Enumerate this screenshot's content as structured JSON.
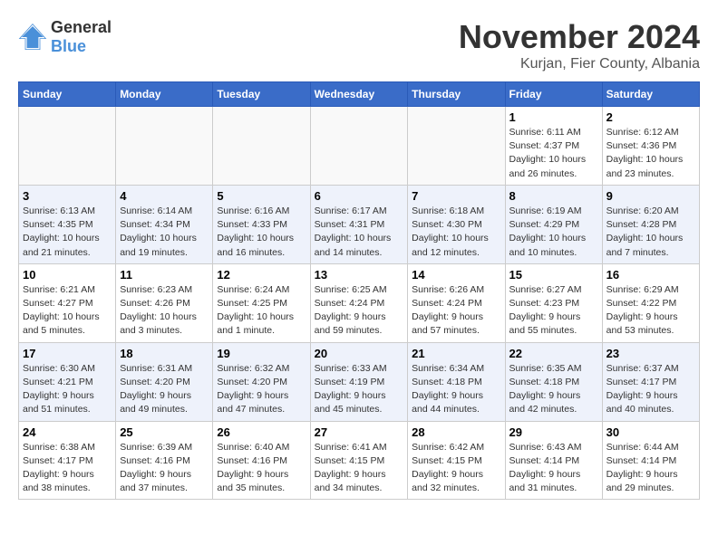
{
  "header": {
    "logo_general": "General",
    "logo_blue": "Blue",
    "month_title": "November 2024",
    "location": "Kurjan, Fier County, Albania"
  },
  "weekdays": [
    "Sunday",
    "Monday",
    "Tuesday",
    "Wednesday",
    "Thursday",
    "Friday",
    "Saturday"
  ],
  "weeks": [
    [
      {
        "day": "",
        "info": ""
      },
      {
        "day": "",
        "info": ""
      },
      {
        "day": "",
        "info": ""
      },
      {
        "day": "",
        "info": ""
      },
      {
        "day": "",
        "info": ""
      },
      {
        "day": "1",
        "info": "Sunrise: 6:11 AM\nSunset: 4:37 PM\nDaylight: 10 hours and 26 minutes."
      },
      {
        "day": "2",
        "info": "Sunrise: 6:12 AM\nSunset: 4:36 PM\nDaylight: 10 hours and 23 minutes."
      }
    ],
    [
      {
        "day": "3",
        "info": "Sunrise: 6:13 AM\nSunset: 4:35 PM\nDaylight: 10 hours and 21 minutes."
      },
      {
        "day": "4",
        "info": "Sunrise: 6:14 AM\nSunset: 4:34 PM\nDaylight: 10 hours and 19 minutes."
      },
      {
        "day": "5",
        "info": "Sunrise: 6:16 AM\nSunset: 4:33 PM\nDaylight: 10 hours and 16 minutes."
      },
      {
        "day": "6",
        "info": "Sunrise: 6:17 AM\nSunset: 4:31 PM\nDaylight: 10 hours and 14 minutes."
      },
      {
        "day": "7",
        "info": "Sunrise: 6:18 AM\nSunset: 4:30 PM\nDaylight: 10 hours and 12 minutes."
      },
      {
        "day": "8",
        "info": "Sunrise: 6:19 AM\nSunset: 4:29 PM\nDaylight: 10 hours and 10 minutes."
      },
      {
        "day": "9",
        "info": "Sunrise: 6:20 AM\nSunset: 4:28 PM\nDaylight: 10 hours and 7 minutes."
      }
    ],
    [
      {
        "day": "10",
        "info": "Sunrise: 6:21 AM\nSunset: 4:27 PM\nDaylight: 10 hours and 5 minutes."
      },
      {
        "day": "11",
        "info": "Sunrise: 6:23 AM\nSunset: 4:26 PM\nDaylight: 10 hours and 3 minutes."
      },
      {
        "day": "12",
        "info": "Sunrise: 6:24 AM\nSunset: 4:25 PM\nDaylight: 10 hours and 1 minute."
      },
      {
        "day": "13",
        "info": "Sunrise: 6:25 AM\nSunset: 4:24 PM\nDaylight: 9 hours and 59 minutes."
      },
      {
        "day": "14",
        "info": "Sunrise: 6:26 AM\nSunset: 4:24 PM\nDaylight: 9 hours and 57 minutes."
      },
      {
        "day": "15",
        "info": "Sunrise: 6:27 AM\nSunset: 4:23 PM\nDaylight: 9 hours and 55 minutes."
      },
      {
        "day": "16",
        "info": "Sunrise: 6:29 AM\nSunset: 4:22 PM\nDaylight: 9 hours and 53 minutes."
      }
    ],
    [
      {
        "day": "17",
        "info": "Sunrise: 6:30 AM\nSunset: 4:21 PM\nDaylight: 9 hours and 51 minutes."
      },
      {
        "day": "18",
        "info": "Sunrise: 6:31 AM\nSunset: 4:20 PM\nDaylight: 9 hours and 49 minutes."
      },
      {
        "day": "19",
        "info": "Sunrise: 6:32 AM\nSunset: 4:20 PM\nDaylight: 9 hours and 47 minutes."
      },
      {
        "day": "20",
        "info": "Sunrise: 6:33 AM\nSunset: 4:19 PM\nDaylight: 9 hours and 45 minutes."
      },
      {
        "day": "21",
        "info": "Sunrise: 6:34 AM\nSunset: 4:18 PM\nDaylight: 9 hours and 44 minutes."
      },
      {
        "day": "22",
        "info": "Sunrise: 6:35 AM\nSunset: 4:18 PM\nDaylight: 9 hours and 42 minutes."
      },
      {
        "day": "23",
        "info": "Sunrise: 6:37 AM\nSunset: 4:17 PM\nDaylight: 9 hours and 40 minutes."
      }
    ],
    [
      {
        "day": "24",
        "info": "Sunrise: 6:38 AM\nSunset: 4:17 PM\nDaylight: 9 hours and 38 minutes."
      },
      {
        "day": "25",
        "info": "Sunrise: 6:39 AM\nSunset: 4:16 PM\nDaylight: 9 hours and 37 minutes."
      },
      {
        "day": "26",
        "info": "Sunrise: 6:40 AM\nSunset: 4:16 PM\nDaylight: 9 hours and 35 minutes."
      },
      {
        "day": "27",
        "info": "Sunrise: 6:41 AM\nSunset: 4:15 PM\nDaylight: 9 hours and 34 minutes."
      },
      {
        "day": "28",
        "info": "Sunrise: 6:42 AM\nSunset: 4:15 PM\nDaylight: 9 hours and 32 minutes."
      },
      {
        "day": "29",
        "info": "Sunrise: 6:43 AM\nSunset: 4:14 PM\nDaylight: 9 hours and 31 minutes."
      },
      {
        "day": "30",
        "info": "Sunrise: 6:44 AM\nSunset: 4:14 PM\nDaylight: 9 hours and 29 minutes."
      }
    ]
  ]
}
